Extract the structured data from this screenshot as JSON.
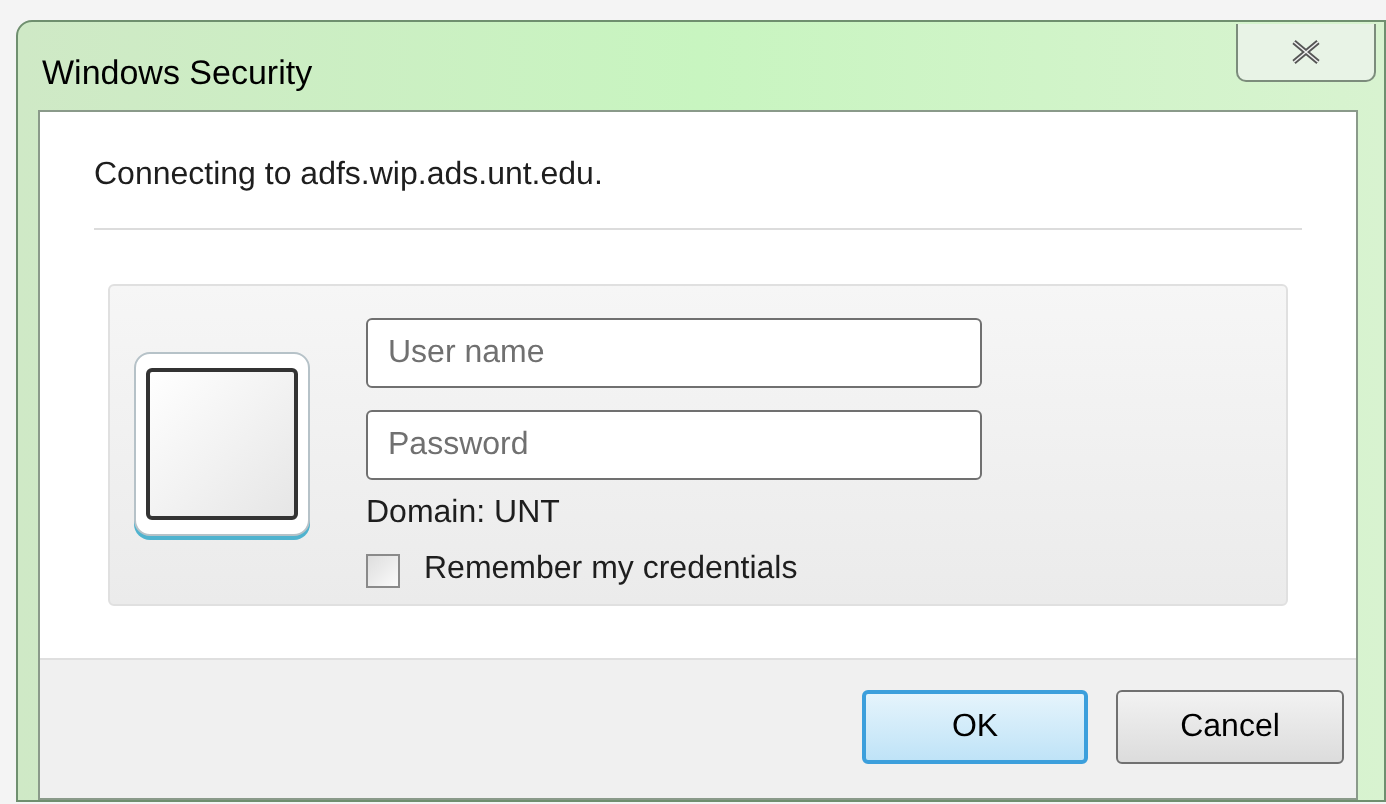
{
  "window": {
    "title": "Windows Security"
  },
  "message": "Connecting to adfs.wip.ads.unt.edu.",
  "fields": [
    {
      "placeholder": "User name"
    },
    {
      "placeholder": "Password"
    }
  ],
  "domain": "Domain: UNT",
  "remember": {
    "label": "Remember my credentials",
    "checked": false
  },
  "buttons": [
    {
      "label": "OK",
      "default": true
    },
    {
      "label": "Cancel",
      "default": false
    }
  ]
}
